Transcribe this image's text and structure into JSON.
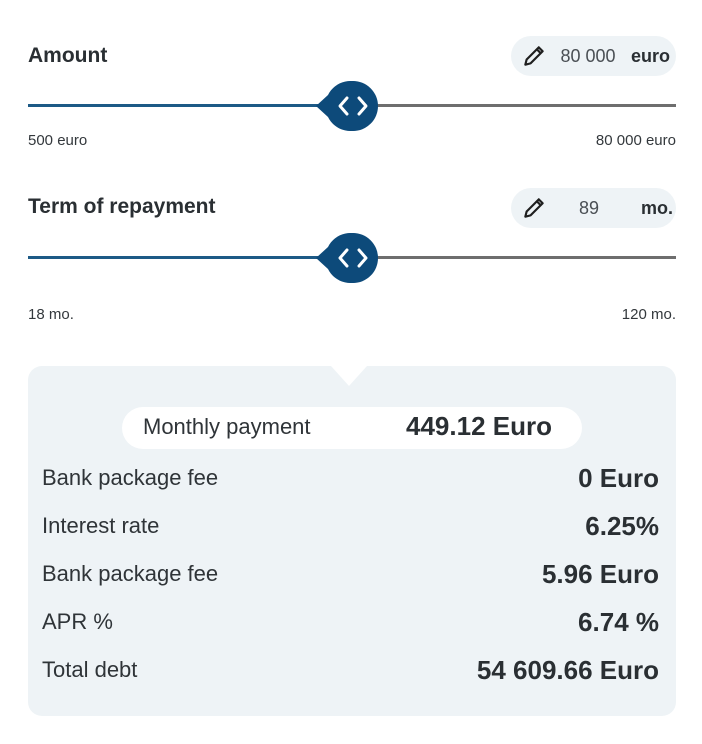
{
  "amount": {
    "label": "Amount",
    "value": "80 000",
    "unit": "euro",
    "min_label": "500 euro",
    "max_label": "80 000 euro",
    "slider_fraction": 0.5
  },
  "term": {
    "label": "Term of repayment",
    "value": "89",
    "unit": "mo.",
    "min_label": "18 mo.",
    "max_label": "120 mo.",
    "slider_fraction": 0.5
  },
  "summary": {
    "monthly_payment_label": "Monthly payment",
    "monthly_payment_value": "449.12 Euro",
    "rows": [
      {
        "label": "Bank package fee",
        "value": "0  Euro"
      },
      {
        "label": "Interest rate",
        "value": "6.25%"
      },
      {
        "label": "Bank package fee",
        "value": "5.96 Euro"
      },
      {
        "label": "APR %",
        "value": "6.74 %"
      },
      {
        "label": "Total debt",
        "value": "54 609.66 Euro"
      }
    ]
  },
  "icons": {
    "edit": "pencil-icon",
    "slider_handle": "chevrons-left-right-icon"
  },
  "colors": {
    "accent": "#0d4a7a",
    "track_filled": "#1d5a86",
    "track_empty": "#6e6e6e",
    "panel_bg": "#eef3f6"
  }
}
